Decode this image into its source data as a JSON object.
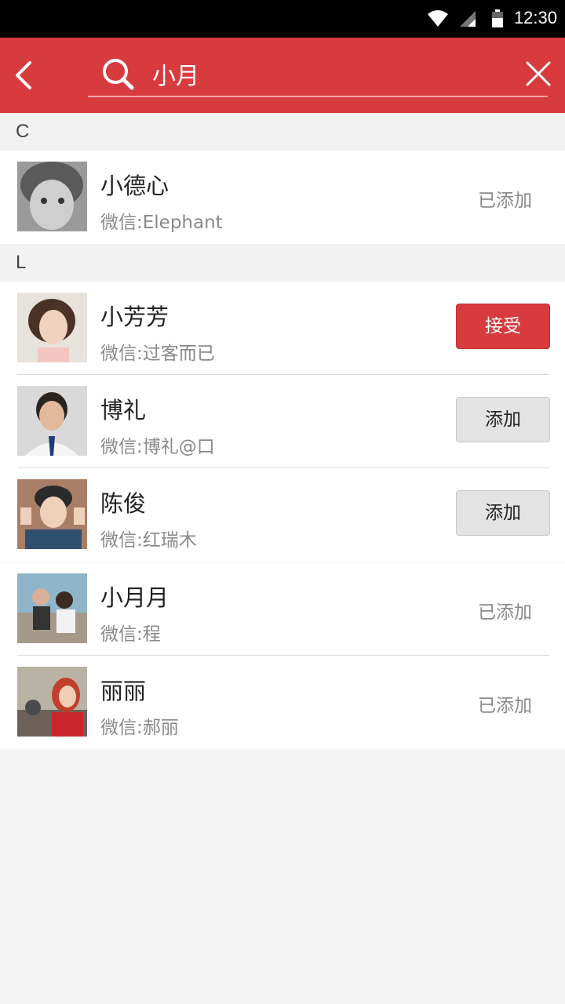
{
  "status_bar": {
    "time": "12:30"
  },
  "search": {
    "query": "小月"
  },
  "sections": [
    {
      "letter": "C"
    },
    {
      "letter": "L"
    }
  ],
  "contacts": [
    {
      "name": "小德心",
      "wechat": "微信:Elephant",
      "action": "已添加",
      "action_type": "status"
    },
    {
      "name": "小芳芳",
      "wechat": "微信:过客而已",
      "action": "接受",
      "action_type": "accept"
    },
    {
      "name": "博礼",
      "wechat": "微信:博礼@口",
      "action": "添加",
      "action_type": "add"
    },
    {
      "name": "陈俊",
      "wechat": "微信:红瑞木",
      "action": "添加",
      "action_type": "add"
    },
    {
      "name": "小月月",
      "wechat": "微信:程",
      "action": "已添加",
      "action_type": "status"
    },
    {
      "name": "丽丽",
      "wechat": "微信:郝丽",
      "action": "已添加",
      "action_type": "status"
    }
  ],
  "colors": {
    "accent": "#d83b3e",
    "header_bg": "#f2f2f2",
    "secondary_text": "#8a8a8a"
  },
  "icons": [
    "wifi-icon",
    "signal-icon",
    "battery-icon",
    "back-arrow-icon",
    "search-icon",
    "clear-icon"
  ]
}
